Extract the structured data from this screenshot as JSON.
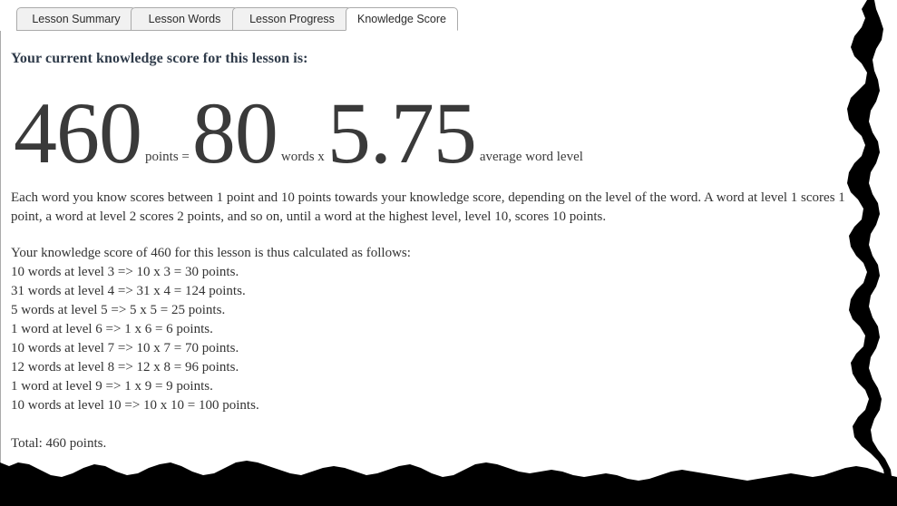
{
  "tabs": [
    {
      "label": "Lesson Summary",
      "active": false
    },
    {
      "label": "Lesson Words",
      "active": false
    },
    {
      "label": "Lesson Progress",
      "active": false
    },
    {
      "label": "Knowledge Score",
      "active": true
    }
  ],
  "heading": "Your current knowledge score for this lesson is:",
  "equation": {
    "score": "460",
    "score_label": "points =",
    "words": "80",
    "words_label": "words x",
    "average_level": "5.75",
    "average_label": "average word level"
  },
  "intro_paragraph": "Each word you know scores between 1 point and 10 points towards your knowledge score, depending on the level of the word. A word at level 1 scores 1 point, a word at level 2 scores 2 points, and so on, until a word at the highest level, level 10, scores 10 points.",
  "calc_intro": "Your knowledge score of 460 for this lesson is thus calculated as follows:",
  "calc_lines": [
    "10 words at level 3 => 10 x 3 = 30 points.",
    "31 words at level 4 => 31 x 4 = 124 points.",
    "5 words at level 5 => 5 x 5 = 25 points.",
    "1 word at level 6 => 1 x 6 = 6 points.",
    "10 words at level 7 => 10 x 7 = 70 points.",
    "12 words at level 8 => 12 x 8 = 96 points.",
    "1 word at level 9 => 1 x 9 = 9 points.",
    "10 words at level 10 => 10 x 10 = 100 points."
  ],
  "total_line": "Total: 460 points.",
  "colors": {
    "heading": "#2f3b4a",
    "body_text": "#333333",
    "big_number": "#3a3a3a",
    "tab_border": "#aaaaaa",
    "tab_inactive_bg": "#f1f1f1",
    "tab_active_bg": "#ffffff",
    "torn_edge": "#000000",
    "page_bg": "#ffffff"
  }
}
